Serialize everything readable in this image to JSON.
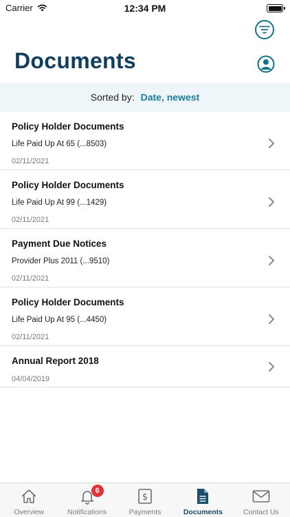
{
  "status_bar": {
    "carrier": "Carrier",
    "time": "12:34 PM"
  },
  "header": {
    "title": "Documents",
    "filter_icon": "filter-lines-icon",
    "profile_icon": "user-circle-icon"
  },
  "sort": {
    "label": "Sorted by:",
    "value": "Date, newest"
  },
  "documents": [
    {
      "title": "Policy Holder Documents",
      "subtitle": "Life Paid Up At 65 (...8503)",
      "date": "02/11/2021"
    },
    {
      "title": "Policy Holder Documents",
      "subtitle": "Life Paid Up At 99 (...1429)",
      "date": "02/11/2021"
    },
    {
      "title": "Payment Due Notices",
      "subtitle": "Provider Plus 2011 (...9510)",
      "date": "02/11/2021"
    },
    {
      "title": "Policy Holder Documents",
      "subtitle": "Life Paid Up At 95 (...4450)",
      "date": "02/11/2021"
    },
    {
      "title": "Annual Report 2018",
      "date": "04/04/2019"
    }
  ],
  "tabs": [
    {
      "label": "Overview",
      "icon": "home-icon"
    },
    {
      "label": "Notifications",
      "icon": "bell-icon",
      "badge": "6"
    },
    {
      "label": "Payments",
      "icon": "dollar-icon"
    },
    {
      "label": "Documents",
      "icon": "document-icon",
      "active": true
    },
    {
      "label": "Contact Us",
      "icon": "envelope-icon"
    }
  ],
  "colors": {
    "title": "#103e5d",
    "accent": "#1a7c98",
    "sort_bg": "#eef6f9",
    "badge": "#e0343a",
    "active_tab": "#1a4a6c"
  }
}
